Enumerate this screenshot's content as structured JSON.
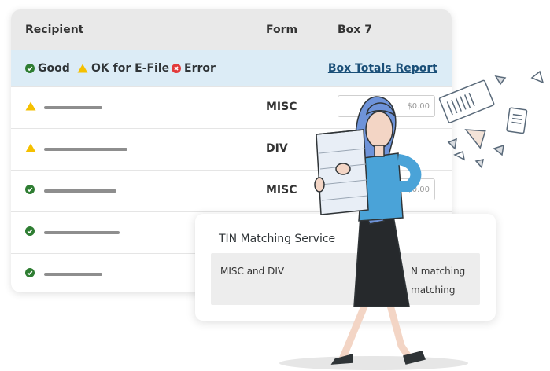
{
  "table": {
    "headers": {
      "recipient": "Recipient",
      "form": "Form",
      "box7": "Box 7"
    },
    "legend": {
      "good": "Good",
      "ok": "OK for E-File",
      "error": "Error",
      "report_link": "Box Totals Report"
    },
    "rows": [
      {
        "status": "warning",
        "form": "MISC",
        "amount": "$0.00"
      },
      {
        "status": "warning",
        "form": "DIV",
        "amount": ""
      },
      {
        "status": "good",
        "form": "MISC",
        "amount": "$0.00"
      },
      {
        "status": "good",
        "form": "",
        "amount": ""
      },
      {
        "status": "good",
        "form": "",
        "amount": ""
      }
    ]
  },
  "tin": {
    "title": "TIN Matching Service",
    "left_text": "MISC and DIV",
    "right_line1": "N matching",
    "right_line2": "matching"
  },
  "colors": {
    "good": "#2e7d32",
    "warning": "#f5c000",
    "error": "#e23b3b",
    "legend_bg": "#dcecf6",
    "link": "#1a4f78"
  }
}
